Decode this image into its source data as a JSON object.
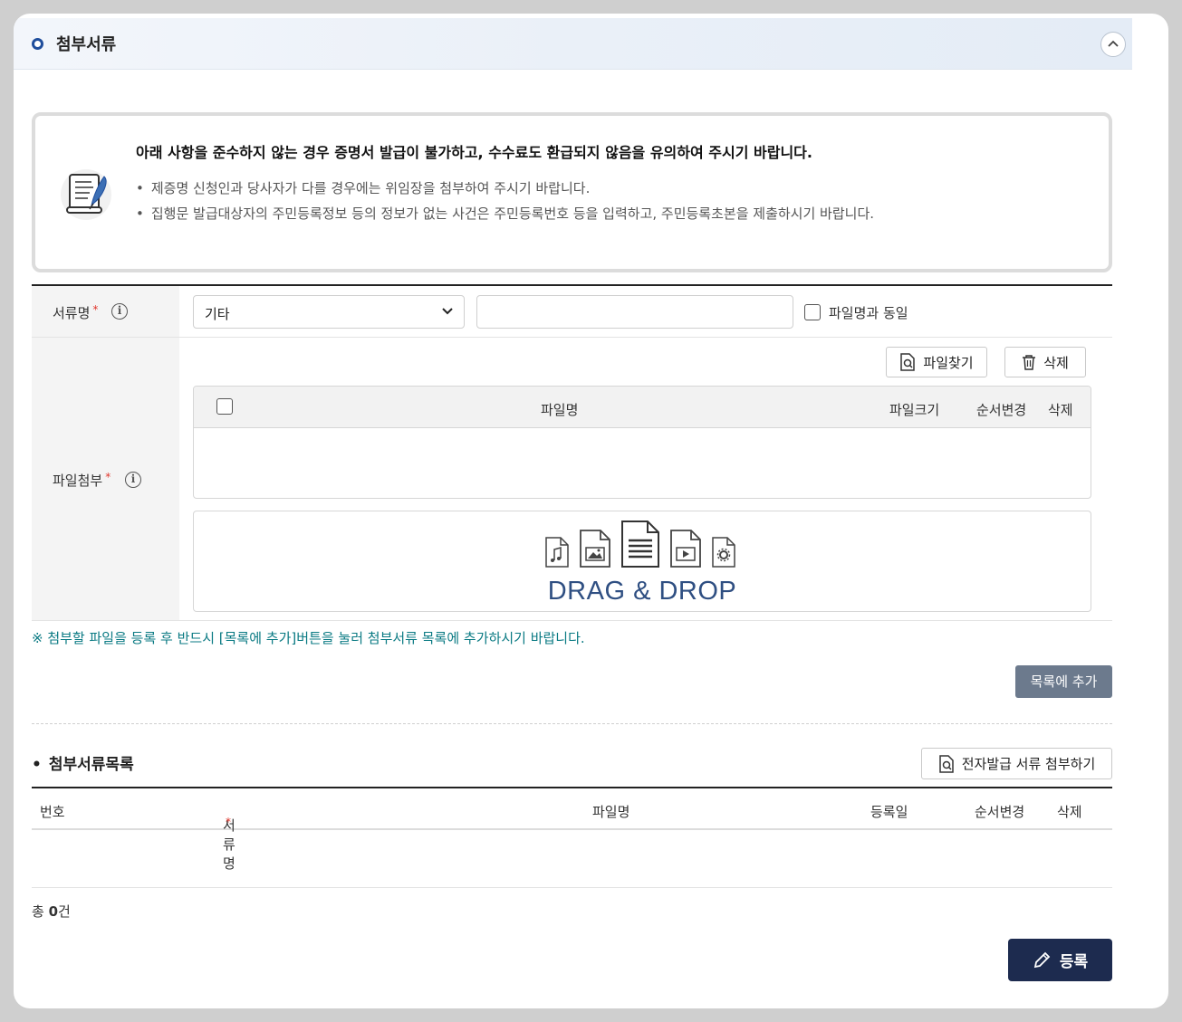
{
  "section": {
    "title": "첨부서류"
  },
  "notice": {
    "heading": "아래 사항을 준수하지 않는 경우 증명서 발급이 불가하고, 수수료도 환급되지 않음을 유의하여 주시기 바랍니다.",
    "items": [
      "제증명 신청인과 당사자가 다를 경우에는 위임장을 첨부하여 주시기 바랍니다.",
      "집행문 발급대상자의 주민등록정보 등의 정보가 없는 사건은 주민등록번호 등을 입력하고, 주민등록초본을 제출하시기 바랍니다."
    ]
  },
  "form": {
    "doc_name_label": "서류명",
    "required_mark": "*",
    "doc_type_selected": "기타",
    "doc_name_input_value": "",
    "same_as_filename_label": "파일명과 동일",
    "file_attach_label": "파일첨부",
    "find_file_button": "파일찾기",
    "delete_button": "삭제",
    "file_table": {
      "columns": [
        "파일명",
        "파일크기",
        "순서변경",
        "삭제"
      ]
    },
    "drop_text": "DRAG & DROP"
  },
  "guide_text": "※ 첨부할 파일을 등록 후 반드시 [목록에 추가]버튼을 눌러 첨부서류 목록에 추가하시기 바랍니다.",
  "add_to_list_button": "목록에 추가",
  "list": {
    "title": "첨부서류목록",
    "edoc_button": "전자발급 서류 첨부하기",
    "columns": [
      "번호",
      "서류명",
      "파일명",
      "등록일",
      "순서변경",
      "삭제"
    ],
    "total_prefix": "총 ",
    "total_count": "0",
    "total_suffix": "건"
  },
  "register_button": "등록"
}
